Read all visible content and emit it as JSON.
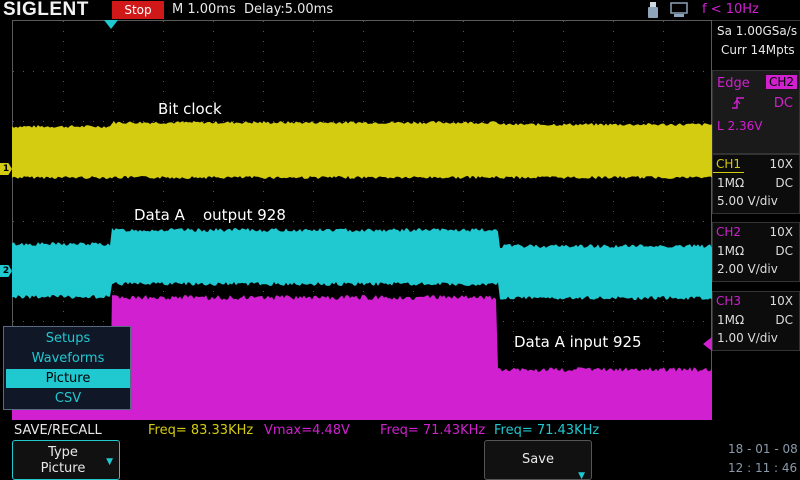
{
  "topbar": {
    "brand": "SIGLENT",
    "run_state": "Stop",
    "timebase": "M 1.00ms",
    "delay": "Delay:5.00ms",
    "freq_limit": "f < 10Hz",
    "icons": [
      "usb-icon",
      "network-icon"
    ]
  },
  "acquisition": {
    "rate": "Sa 1.00GSa/s",
    "depth": "Curr 14Mpts"
  },
  "trigger": {
    "type": "Edge",
    "source": "CH2",
    "slope": "rising-edge-icon",
    "coupling": "DC",
    "level": "L  2.36V"
  },
  "channels": [
    {
      "name": "CH1",
      "probe": "10X",
      "impedance": "1MΩ",
      "coupling": "DC",
      "scale": "5.00 V/div",
      "color": "#d4cc10"
    },
    {
      "name": "CH2",
      "probe": "10X",
      "impedance": "1MΩ",
      "coupling": "DC",
      "scale": "2.00 V/div",
      "color": "#d020d0"
    },
    {
      "name": "CH3",
      "probe": "10X",
      "impedance": "1MΩ",
      "coupling": "DC",
      "scale": "1.00 V/div",
      "color": "#d020d0"
    }
  ],
  "annotations": {
    "bit_clock": "Bit clock",
    "data_a": "Data A",
    "output": "output 928",
    "input": "Data A input 925"
  },
  "menu": {
    "title": "SAVE/RECALL",
    "items": [
      "Setups",
      "Waveforms",
      "Picture",
      "CSV"
    ],
    "selected": "Picture"
  },
  "measurements": [
    {
      "text": "Freq= 83.33KHz",
      "color": "#d4cc10"
    },
    {
      "text": "Vmax=4.48V",
      "color": "#d020d0"
    },
    {
      "text": "Freq= 71.43KHz",
      "color": "#d020d0"
    },
    {
      "text": "Freq= 71.43KHz",
      "color": "#20c8d0"
    }
  ],
  "softkeys": {
    "type_label": "Type",
    "type_value": "Picture",
    "save_label": "Save"
  },
  "datetime": {
    "date": "18 - 01 - 08",
    "time": "12 : 11 : 46"
  },
  "colors": {
    "ch1": "#d4cc10",
    "ch2": "#20c8d0",
    "ch3": "#d020d0",
    "accent": "#20c8d0",
    "stop": "#d01818"
  }
}
